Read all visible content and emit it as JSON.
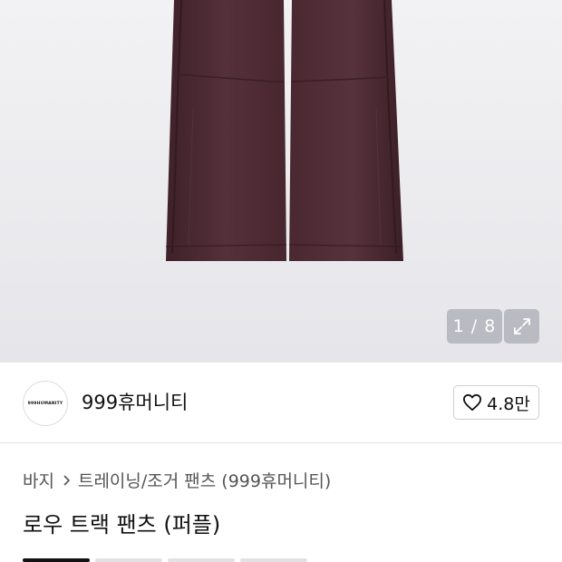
{
  "gallery": {
    "image_subject": "purple-track-pants-photo",
    "counter_current": "1",
    "counter_total": "8",
    "counter_text": "1 / 8",
    "pants_color": "#4d2a35"
  },
  "brand": {
    "logo_text": "999HUMANITY",
    "name": "999휴머니티",
    "likes": "4.8만"
  },
  "breadcrumb": {
    "level1": "바지",
    "level2": "트레이닝/조거 팬츠 (999휴머니티)"
  },
  "product": {
    "title": "로우 트랙 팬츠 (퍼플)"
  },
  "colors": {
    "accent": "#111111",
    "text_secondary": "#555555",
    "divider": "#e4e4e4"
  }
}
